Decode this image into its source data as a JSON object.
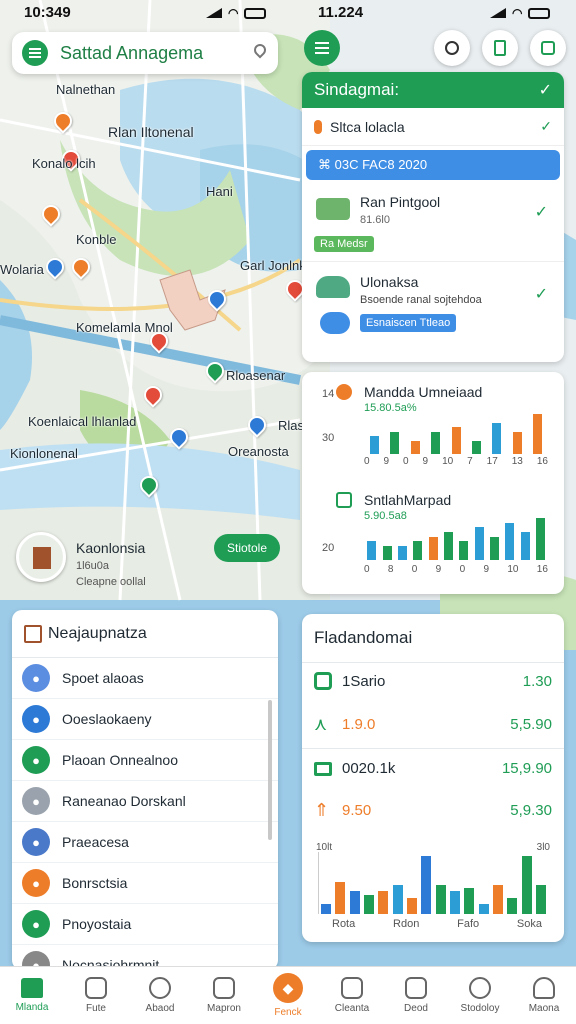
{
  "status_left": {
    "time": "10:349"
  },
  "status_right": {
    "time": "11.224"
  },
  "search": {
    "title": "Sattad Annagema"
  },
  "map_labels": [
    "Nalnethan",
    "Rlan Iltonenal",
    "Konalo lcih",
    "Hani",
    "Konble",
    "Wolaria",
    "Garl Jonlnk",
    "Komelamla Mnol",
    "Rloasenar",
    "Koenlaical lhlanlad",
    "Rlas",
    "Kionlonenal",
    "Oreanosta"
  ],
  "place": {
    "name": "Kaonlonsia",
    "sub1": "1l6u0a",
    "sub2": "Cleapne oollal",
    "action": "Stiotole"
  },
  "list_panel": {
    "title": "Neajaupnatza",
    "items": [
      {
        "label": "Spoet alaoas",
        "color": "#5b8de0"
      },
      {
        "label": "Ooeslaokaeny",
        "color": "#2d7ad6"
      },
      {
        "label": "Plaoan Onnealnoo",
        "color": "#1f9d55"
      },
      {
        "label": "Raneanao Dorskanl",
        "color": "#9aa3ad"
      },
      {
        "label": "Praeacesa",
        "color": "#4a79c9"
      },
      {
        "label": "Bonrsctsia",
        "color": "#ee7d2a"
      },
      {
        "label": "Pnoyostaia",
        "color": "#1f9d55"
      },
      {
        "label": "Nocnasiohrmnit",
        "color": "#888888"
      }
    ]
  },
  "dropdown": {
    "title": "Sindagmai:",
    "filter": "Sltca  lolacla",
    "date_pill": "⌘ 03C FAC8 2020",
    "items": [
      {
        "title": "Ran Pintgool",
        "sub": "81.6l0",
        "tag": "Ra Medsr"
      },
      {
        "title": "Ulonaksa",
        "sub": "Bsoende ranal sojtehdoa",
        "tag": "Esnaiscen Ttleao"
      }
    ]
  },
  "mini_charts": [
    {
      "title": "Mandda Umneiaad",
      "sub": "15.80.5a%",
      "ytop": "14",
      "ybot": "30",
      "ticks": [
        "0",
        "9",
        "0",
        "9",
        "10",
        "7",
        "17",
        "13",
        "16"
      ]
    },
    {
      "title": "SntlahMarpad",
      "sub": "5.90.5a8",
      "ytop": "",
      "ybot": "20",
      "ticks": [
        "0",
        "8",
        "0",
        "9",
        "0",
        "9",
        "10",
        "16"
      ]
    }
  ],
  "chart_data": [
    {
      "type": "bar",
      "title": "Mandda Umneiaad",
      "categories": [
        "0",
        "9",
        "0",
        "9",
        "10",
        "7",
        "17",
        "13",
        "16"
      ],
      "values": [
        4,
        5,
        3,
        5,
        6,
        3,
        7,
        5,
        9
      ],
      "colors": [
        "#2d9dd6",
        "#1f9d55",
        "#ee7d2a",
        "#1f9d55",
        "#ee7d2a",
        "#1f9d55",
        "#2d9dd6",
        "#ee7d2a",
        "#ee7d2a"
      ]
    },
    {
      "type": "bar",
      "title": "SntlahMarpad",
      "categories": [
        "0",
        "8",
        "0",
        "9",
        "0",
        "9",
        "10",
        "16"
      ],
      "values": [
        4,
        3,
        3,
        4,
        5,
        6,
        4,
        7,
        5,
        8,
        6,
        9
      ],
      "colors": [
        "#2d9dd6",
        "#1f9d55",
        "#2d9dd6",
        "#1f9d55",
        "#ee7d2a",
        "#1f9d55",
        "#1f9d55",
        "#2d9dd6",
        "#1f9d55",
        "#2d9dd6",
        "#2d9dd6",
        "#1f9d55"
      ]
    },
    {
      "type": "bar",
      "title": "Fladandomai",
      "categories": [
        "Rota",
        "Rdon",
        "Fafo",
        "Soka"
      ],
      "values": [
        3,
        10,
        7,
        6,
        7,
        9,
        5,
        18,
        9,
        7,
        8,
        3,
        9,
        5,
        18,
        9
      ],
      "colors": [
        "#2d7ad6",
        "#ee7d2a",
        "#2d7ad6",
        "#1f9d55",
        "#ee7d2a",
        "#2d9dd6",
        "#ee7d2a",
        "#2d7ad6",
        "#1f9d55",
        "#2d9dd6",
        "#1f9d55",
        "#2d9dd6",
        "#ee7d2a",
        "#1f9d55",
        "#1f9d55",
        "#1f9d55"
      ]
    }
  ],
  "stats_panel": {
    "title": "Fladandomai",
    "rows": [
      {
        "label": "1Sario",
        "value": "1.30",
        "color": "#1f9d55"
      },
      {
        "label": "1.9.0",
        "value": "5,5.90",
        "color": "#ee7d2a"
      },
      {
        "label": "0020.1k",
        "value": "15,9.90",
        "color": "#1f9d55"
      },
      {
        "label": "9.50",
        "value": "5,9.30",
        "color": "#ee7d2a"
      }
    ],
    "ytop_left": "10lt",
    "ytop_right": "3l0",
    "xlabels": [
      "Rota",
      "Rdon",
      "Fafo",
      "Soka"
    ]
  },
  "nav": [
    {
      "label": "Mlanda"
    },
    {
      "label": "Fute"
    },
    {
      "label": "Abaod"
    },
    {
      "label": "Mapron"
    },
    {
      "label": "Fenck"
    },
    {
      "label": "Cleanta"
    },
    {
      "label": "Deod"
    },
    {
      "label": "Stodoloy"
    },
    {
      "label": "Maona"
    }
  ]
}
